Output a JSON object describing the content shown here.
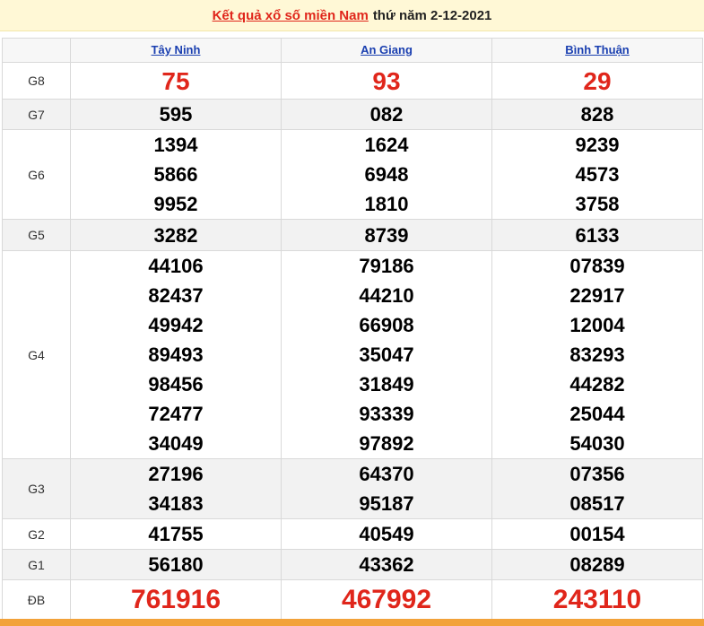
{
  "header": {
    "title_link": "Kết quả xổ số miền Nam",
    "title_rest": "thứ năm 2-12-2021"
  },
  "provinces": [
    "Tây Ninh",
    "An Giang",
    "Bình Thuận"
  ],
  "prizes": [
    {
      "label": "G8",
      "values": [
        [
          "75"
        ],
        [
          "93"
        ],
        [
          "29"
        ]
      ]
    },
    {
      "label": "G7",
      "values": [
        [
          "595"
        ],
        [
          "082"
        ],
        [
          "828"
        ]
      ]
    },
    {
      "label": "G6",
      "values": [
        [
          "1394",
          "5866",
          "9952"
        ],
        [
          "1624",
          "6948",
          "1810"
        ],
        [
          "9239",
          "4573",
          "3758"
        ]
      ]
    },
    {
      "label": "G5",
      "values": [
        [
          "3282"
        ],
        [
          "8739"
        ],
        [
          "6133"
        ]
      ]
    },
    {
      "label": "G4",
      "values": [
        [
          "44106",
          "82437",
          "49942",
          "89493",
          "98456",
          "72477",
          "34049"
        ],
        [
          "79186",
          "44210",
          "66908",
          "35047",
          "31849",
          "93339",
          "97892"
        ],
        [
          "07839",
          "22917",
          "12004",
          "83293",
          "44282",
          "25044",
          "54030"
        ]
      ]
    },
    {
      "label": "G3",
      "values": [
        [
          "27196",
          "34183"
        ],
        [
          "64370",
          "95187"
        ],
        [
          "07356",
          "08517"
        ]
      ]
    },
    {
      "label": "G2",
      "values": [
        [
          "41755"
        ],
        [
          "40549"
        ],
        [
          "00154"
        ]
      ]
    },
    {
      "label": "G1",
      "values": [
        [
          "56180"
        ],
        [
          "43362"
        ],
        [
          "08289"
        ]
      ]
    },
    {
      "label": "ĐB",
      "values": [
        [
          "761916"
        ],
        [
          "467992"
        ],
        [
          "243110"
        ]
      ]
    }
  ],
  "colors": {
    "highlight_red": "#e0261b",
    "province_link": "#1a3fb0",
    "title_background": "#fff8d6",
    "bottom_bar": "#f2a23a"
  }
}
